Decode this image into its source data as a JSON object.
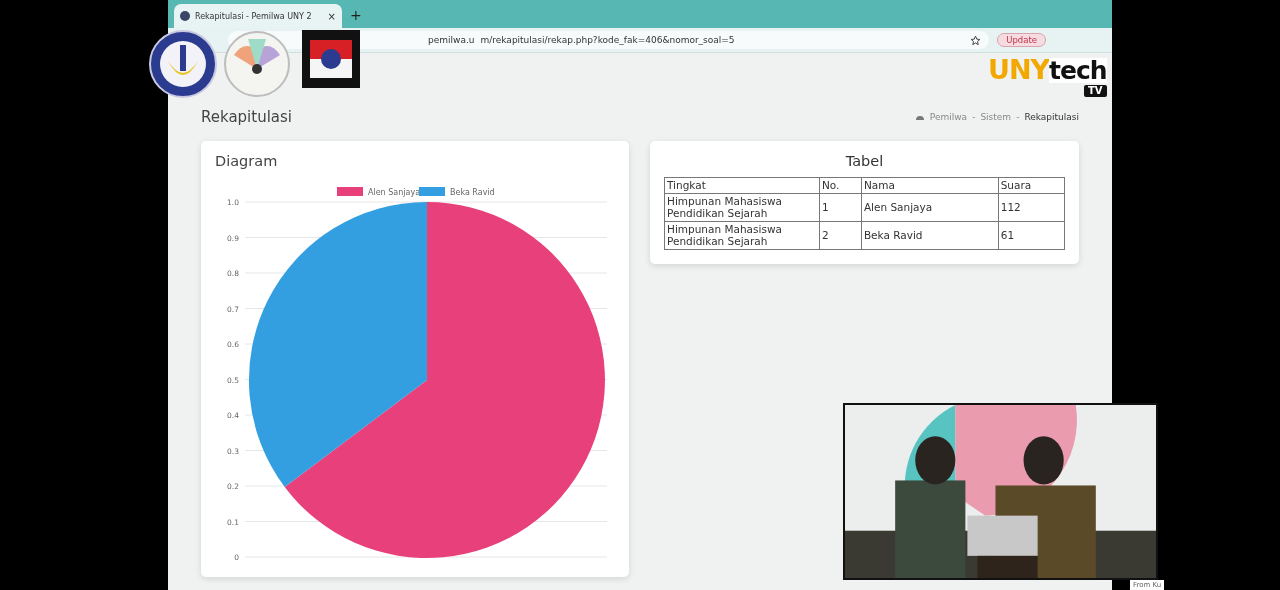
{
  "browser": {
    "tab_title": "Rekapitulasi - Pemilwa UNY 2",
    "new_tab": "+",
    "close": "×",
    "url_start": "pemilwa.u",
    "url_end": "m/rekapitulasi/rekap.php?kode_fak=406&nomor_soal=5",
    "update_button": "Update"
  },
  "overlay": {
    "logo_text": [
      "UNY",
      "tech",
      "TV"
    ],
    "caption": "From Ku"
  },
  "page": {
    "title": "Rekapitulasi",
    "breadcrumb": [
      "Pemilwa",
      "Sistem",
      "Rekapitulasi"
    ],
    "separator": "-"
  },
  "diagram": {
    "title": "Diagram",
    "chart_data": {
      "type": "pie",
      "categories": [
        "Alen Sanjaya",
        "Beka Ravid"
      ],
      "values": [
        64.74,
        35.26
      ],
      "colors": [
        "#e8407a",
        "#339ee0"
      ],
      "legend": "top"
    },
    "axis_labels": [
      "1.0",
      "0.9",
      "0.8",
      "0.7",
      "0.6",
      "0.5",
      "0.4",
      "0.3",
      "0.2",
      "0.1",
      "0"
    ]
  },
  "table": {
    "title": "Tabel",
    "columns": [
      "Tingkat",
      "No.",
      "Nama",
      "Suara"
    ],
    "rows": [
      [
        "Himpunan Mahasiswa Pendidikan Sejarah",
        "1",
        "Alen Sanjaya",
        "112"
      ],
      [
        "Himpunan Mahasiswa Pendidikan Sejarah",
        "2",
        "Beka Ravid",
        "61"
      ]
    ]
  }
}
